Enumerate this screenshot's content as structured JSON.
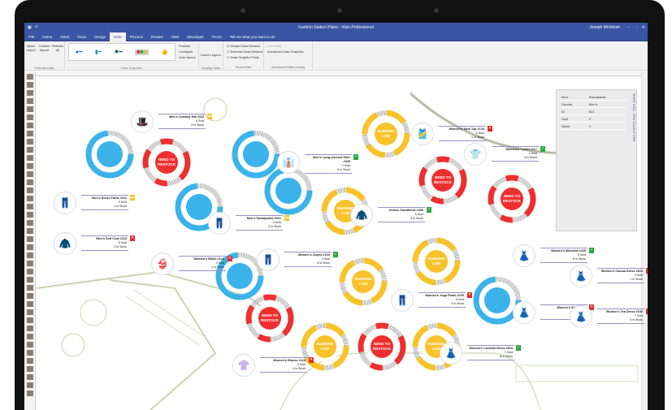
{
  "app": {
    "title": "Fashion Station Plans - Visio Professional",
    "user": "Joseph McIntosh"
  },
  "tabs": [
    "File",
    "Home",
    "Insert",
    "Draw",
    "Design",
    "Data",
    "Process",
    "Review",
    "View",
    "Developer",
    "PLAN"
  ],
  "active_tab": "Data",
  "tell_me": "Tell me what you want to do",
  "ribbon": {
    "external_data": {
      "label": "External Data",
      "buttons": [
        "Quick Import",
        "Custom Import",
        "Refresh All"
      ]
    },
    "data_graphics": {
      "label": "Data Graphics",
      "buttons": [
        "Position",
        "Configure",
        "Auto Space"
      ]
    },
    "display_data": {
      "label": "Display Data",
      "buttons": [
        "Insert Legend"
      ]
    },
    "show_hide": {
      "label": "Show/Hide",
      "checkboxes": [
        {
          "label": "Shape Data Window",
          "checked": true
        },
        {
          "label": "External Data Window",
          "checked": false
        },
        {
          "label": "Data Graphic Fields",
          "checked": false
        }
      ]
    },
    "advanced": {
      "label": "Advanced Data Linking",
      "buttons": [
        "Link Data",
        "Advanced Data Graphics"
      ]
    }
  },
  "colors": {
    "blue": "#3bb3ea",
    "red": "#ee2f2f",
    "yellow": "#f8c22a",
    "accent": "#3955a3"
  },
  "shape_data": {
    "title": "SHAPE DATA - ITEM CALLOUT ITEM",
    "rows": [
      [
        "Item",
        "Sweatpants"
      ],
      [
        "Gender",
        "Men's"
      ],
      [
        "ID",
        "621"
      ],
      [
        "Sold",
        "9"
      ],
      [
        "Stock",
        "3"
      ]
    ]
  },
  "donuts": [
    {
      "status": "blue",
      "label": ""
    },
    {
      "status": "red",
      "label": "NEED TO RESTOCK"
    },
    {
      "status": "blue",
      "label": ""
    },
    {
      "status": "blue",
      "label": ""
    },
    {
      "status": "blue",
      "label": ""
    },
    {
      "status": "yellow",
      "label": "RUNNING LOW"
    },
    {
      "status": "yellow",
      "label": "RUNNING LOW"
    },
    {
      "status": "red",
      "label": "NEED TO RESTOCK"
    },
    {
      "status": "red",
      "label": "NEED TO RESTOCK"
    },
    {
      "status": "blue",
      "label": ""
    },
    {
      "status": "red",
      "label": "NEED TO RESTOCK"
    },
    {
      "status": "yellow",
      "label": "RUNNING LOW"
    },
    {
      "status": "yellow",
      "label": "RUNNING LOW"
    },
    {
      "status": "blue",
      "label": ""
    },
    {
      "status": "yellow",
      "label": "RUNNING LOW"
    },
    {
      "status": "red",
      "label": "NEED TO RESTOCK"
    },
    {
      "status": "yellow",
      "label": "RUNNING LOW"
    }
  ],
  "items": [
    {
      "name": "Men's Cowboy Hat #118",
      "sold": "6 Sold",
      "stock": "3 in Stock",
      "badge": "warn"
    },
    {
      "name": "Men's Dress Pants #112",
      "sold": "5 Sold",
      "stock": "4 in Stock",
      "badge": "warn"
    },
    {
      "name": "Men's Suit Coat #115",
      "sold": "5 Sold",
      "stock": "3 in Stock",
      "badge": "bad"
    },
    {
      "name": "Men's Sweatpants #621",
      "sold": "9 Sold",
      "stock": "3 in Stock",
      "badge": "warn"
    },
    {
      "name": "Men's Long-sleeved Shirt #045",
      "sold": "2 Sold",
      "stock": "8 in Stock",
      "badge": "ok"
    },
    {
      "name": "Women's Tank Top #134",
      "sold": "8 Sold",
      "stock": "2 in Stock",
      "badge": "bad"
    },
    {
      "name": "Women's T-shirt #117",
      "sold": "2 Sold",
      "stock": "6 in Stock",
      "badge": "ok"
    },
    {
      "name": "Unisex Sweatshirt #456",
      "sold": "5 Sold",
      "stock": "8 in Stock",
      "badge": "ok"
    },
    {
      "name": "Women's Bikini #123",
      "sold": "4 Sold",
      "stock": "4 in Stock",
      "badge": "bad"
    },
    {
      "name": "Women's Capris #210",
      "sold": "2 Sold",
      "stock": "8 in Stock",
      "badge": "ok"
    },
    {
      "name": "Women's Yoga Pants #230",
      "sold": "8 Sold",
      "stock": "0 in Stock",
      "badge": "bad"
    },
    {
      "name": "Women's Miniskirt #425",
      "sold": "8 Sold",
      "stock": "8 in Stock",
      "badge": "ok"
    },
    {
      "name": "Women's Casual Dress #824",
      "sold": "9 Sold",
      "stock": "1 in Stock",
      "badge": "bad"
    },
    {
      "name": "Women's Skirt #543",
      "sold": "8 Sold",
      "stock": "2 in Stock",
      "badge": "bad"
    },
    {
      "name": "Women's Tea Dress #192",
      "sold": "7 Sold",
      "stock": "0 in Stock",
      "badge": "bad"
    },
    {
      "name": "Women's Blouse #116",
      "sold": "8 Sold",
      "stock": "4 in Stock",
      "badge": "bad"
    },
    {
      "name": "Women's Cocktail Dress #818",
      "sold": "1 Sold",
      "stock": "8 in Stock",
      "badge": "ok"
    }
  ]
}
